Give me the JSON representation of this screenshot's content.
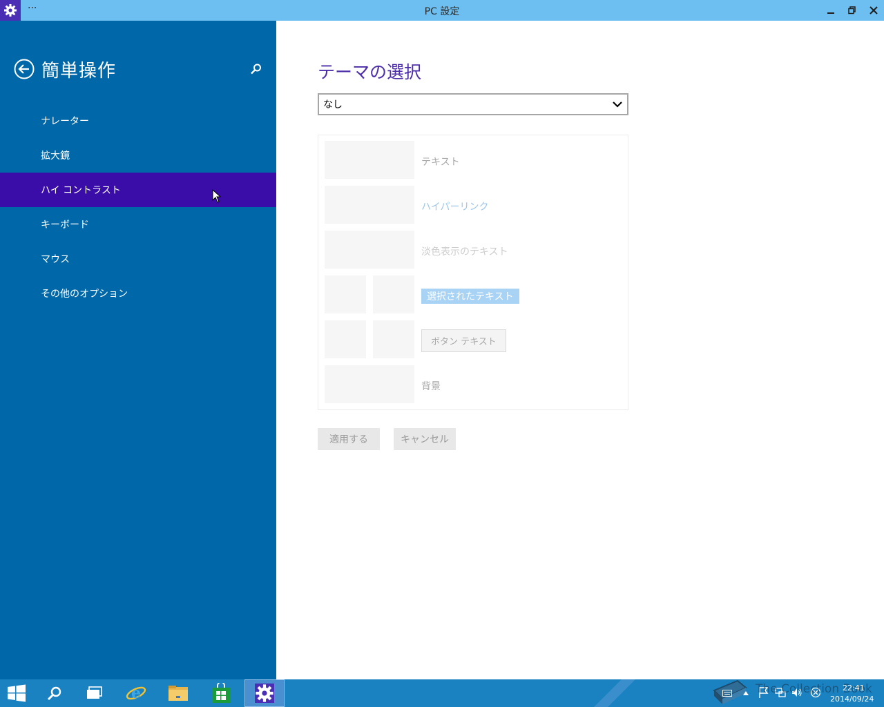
{
  "titlebar": {
    "more": "···",
    "title": "PC 設定"
  },
  "sidebar": {
    "heading": "簡単操作",
    "items": [
      {
        "label": "ナレーター",
        "active": false
      },
      {
        "label": "拡大鏡",
        "active": false
      },
      {
        "label": "ハイ コントラスト",
        "active": true
      },
      {
        "label": "キーボード",
        "active": false
      },
      {
        "label": "マウス",
        "active": false
      },
      {
        "label": "その他のオプション",
        "active": false
      }
    ]
  },
  "main": {
    "page_title": "テーマの選択",
    "theme_select": {
      "value": "なし"
    },
    "preview": {
      "text": "テキスト",
      "hyperlink": "ハイパーリンク",
      "dimmed_text": "淡色表示のテキスト",
      "selected_text": "選択されたテキスト",
      "button_text": "ボタン テキスト",
      "background": "背景"
    },
    "apply_label": "適用する",
    "cancel_label": "キャンセル"
  },
  "taskbar": {
    "time": "22:41",
    "date": "2014/09/24",
    "watermark": "The Collection Book"
  },
  "colors": {
    "titlebar": "#6cbff0",
    "sidebar": "#0068a8",
    "active_nav": "#3a0ca8",
    "accent_title": "#4b2da8",
    "taskbar": "#1b82c2"
  }
}
